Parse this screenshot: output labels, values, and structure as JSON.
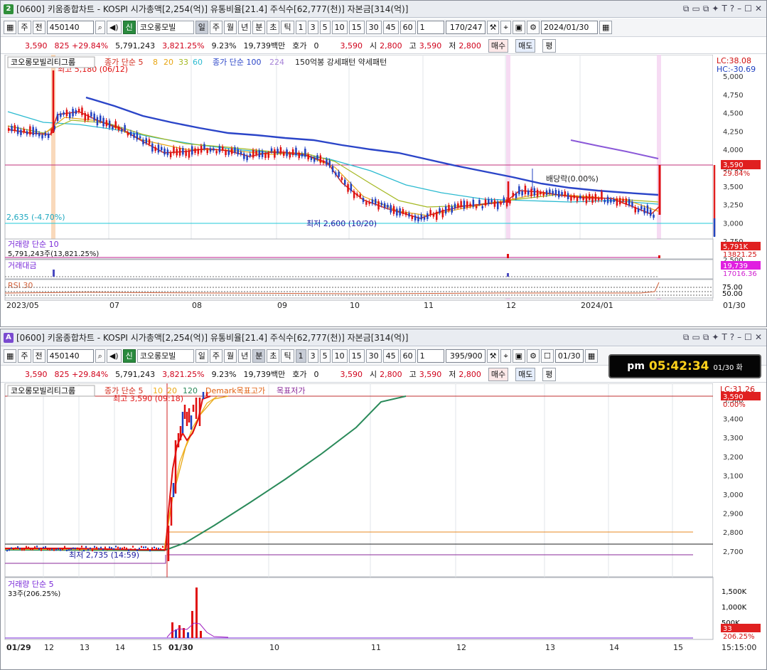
{
  "w1": {
    "badge": "2",
    "title": "[0600] 키움종합차트 - KOSPI 시가총액[2,254(억)] 유통비율[21.4] 주식수[62,777(천)] 자본금[314(억)]",
    "period": "주",
    "opt": "전",
    "code": "450140",
    "name": "코오롱모빌",
    "tabs": [
      "일",
      "주",
      "월",
      "년",
      "분",
      "초",
      "틱"
    ],
    "sel": "일",
    "nums": [
      "1",
      "3",
      "5",
      "10",
      "15",
      "30",
      "45",
      "60"
    ],
    "cnt": "1",
    "page": "170/247",
    "date": "2024/01/30",
    "price": "3,590",
    "chg": "825 +29.84%",
    "vol": "5,791,243",
    "volr": "3,821.25%",
    "turn": "9.23%",
    "amt": "19,739백만",
    "hoga": "호가",
    "hoga_v": "0",
    "open_v": "3,590",
    "o": "시",
    "h": "고",
    "l": "저",
    "op": "2,800",
    "hi": "3,590",
    "lo": "2,800",
    "buy": "매수",
    "sell": "매도",
    "even": "평",
    "legend_name": "코오롱모빌리티그룹",
    "legend_ma1": "종가 단순 5",
    "legend_8": "8",
    "legend_20": "20",
    "legend_33": "33",
    "legend_60": "60",
    "legend_ma2": "종가 단순 100",
    "legend_224": "224",
    "legend_ext": "150억봉 강세패턴  약세패턴",
    "hi_note": "최고 5,180 (06/12)",
    "lo_note": "최저 2,600 (10/20)",
    "div_note": "배당락(0.00%)",
    "ref_note": "2,635 (-4.70%)",
    "lc": "LC:38.08",
    "hc": "HC:-30.69",
    "cur_price": "3,590",
    "cur_pct": "29.84%",
    "yticks": [
      "5,000",
      "4,750",
      "4,500",
      "4,250",
      "4,000",
      "3,750",
      "3,500",
      "3,250",
      "3,000",
      "2,750",
      "2,500"
    ],
    "vol_title": "거래량  단순 10",
    "vol_val": "5,791,243주(13,821.25%)",
    "vol_tag": "5,791K",
    "vol_tag2": "13821.25",
    "amt_title": "거래대금",
    "amt_tag": "19,739",
    "amt_tag2": "17016.36",
    "rsi_title": "RSI 30",
    "rsi_t1": "75.00",
    "rsi_t2": "50.00",
    "xticks": [
      "2023/05",
      "07",
      "08",
      "09",
      "10",
      "11",
      "12",
      "2024/01",
      "01/30"
    ]
  },
  "w2": {
    "badge": "A",
    "title": "[0600] 키움종합차트 - KOSPI 시가총액[2,254(억)] 유통비율[21.4] 주식수[62,777(천)] 자본금[314(억)]",
    "period": "주",
    "opt": "전",
    "code": "450140",
    "name": "코오롱모빌",
    "tabs": [
      "일",
      "주",
      "월",
      "년",
      "분",
      "초",
      "틱"
    ],
    "sel": "분",
    "nums": [
      "1",
      "3",
      "5",
      "10",
      "15",
      "30",
      "45",
      "60"
    ],
    "cnt": "1",
    "page": "395/900",
    "date": "01/30",
    "price": "3,590",
    "chg": "825 +29.84%",
    "vol": "5,791,243",
    "volr": "3,821.25%",
    "turn": "9.23%",
    "amt": "19,739백만",
    "hoga": "호가",
    "hoga_v": "0",
    "open_v": "3,590",
    "o": "시",
    "h": "고",
    "l": "저",
    "op": "2,800",
    "hi": "3,590",
    "lo": "2,800",
    "buy": "매수",
    "sell": "매도",
    "even": "평",
    "legend_name": "코오롱모빌리티그룹",
    "legend_ma1": "종가 단순 5",
    "legend_10": "10",
    "legend_20": "20",
    "legend_120": "120",
    "legend_dm": "Demark목표고가",
    "legend_dm2": "목표저가",
    "hi_note": "최고 3,590 (09:18)",
    "lo_note": "최저 2,735 (14:59)",
    "lc": "LC:31.26",
    "cur_price": "3,590",
    "cur_pct": "0.00%",
    "yticks": [
      "3,500",
      "3,400",
      "3,300",
      "3,200",
      "3,100",
      "3,000",
      "2,900",
      "2,800",
      "2,700"
    ],
    "vol_title": "거래량  단순 5",
    "vol_val": "33주(206.25%)",
    "vol_ticks": [
      "1,500K",
      "1,000K",
      "500K"
    ],
    "vol_tag": "33",
    "vol_tag2": "206.25%",
    "xticks": [
      "01/29",
      "12",
      "13",
      "14",
      "15",
      "01/30",
      "10",
      "11",
      "12",
      "13",
      "14",
      "15",
      "15:15:00"
    ]
  },
  "clock": {
    "ampm": "pm",
    "time": "05:42:34",
    "date": "01/30 화"
  }
}
